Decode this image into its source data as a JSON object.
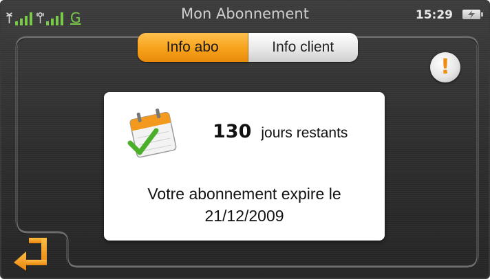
{
  "statusbar": {
    "title": "Mon Abonnement",
    "time": "15:29",
    "network_label": "G",
    "signal_levels": [
      4,
      4
    ],
    "icons": [
      "gps-signal-icon",
      "gsm-signal-icon",
      "gprs-icon",
      "battery-charging-icon"
    ]
  },
  "tabs": [
    {
      "label": "Info abo",
      "active": true
    },
    {
      "label": "Info client",
      "active": false
    }
  ],
  "alert": {
    "glyph": "!",
    "icon": "warning-icon"
  },
  "subscription": {
    "days_count": "130",
    "days_label": "jours restants",
    "expire_text": "Votre abonnement expire le",
    "expire_date": "21/12/2009",
    "icon": "calendar-check-icon"
  },
  "back": {
    "icon": "back-arrow-icon"
  },
  "colors": {
    "accent": "#f7a21b",
    "signal": "#79c94b",
    "background": "#2e2e2e",
    "card": "#ffffff"
  }
}
